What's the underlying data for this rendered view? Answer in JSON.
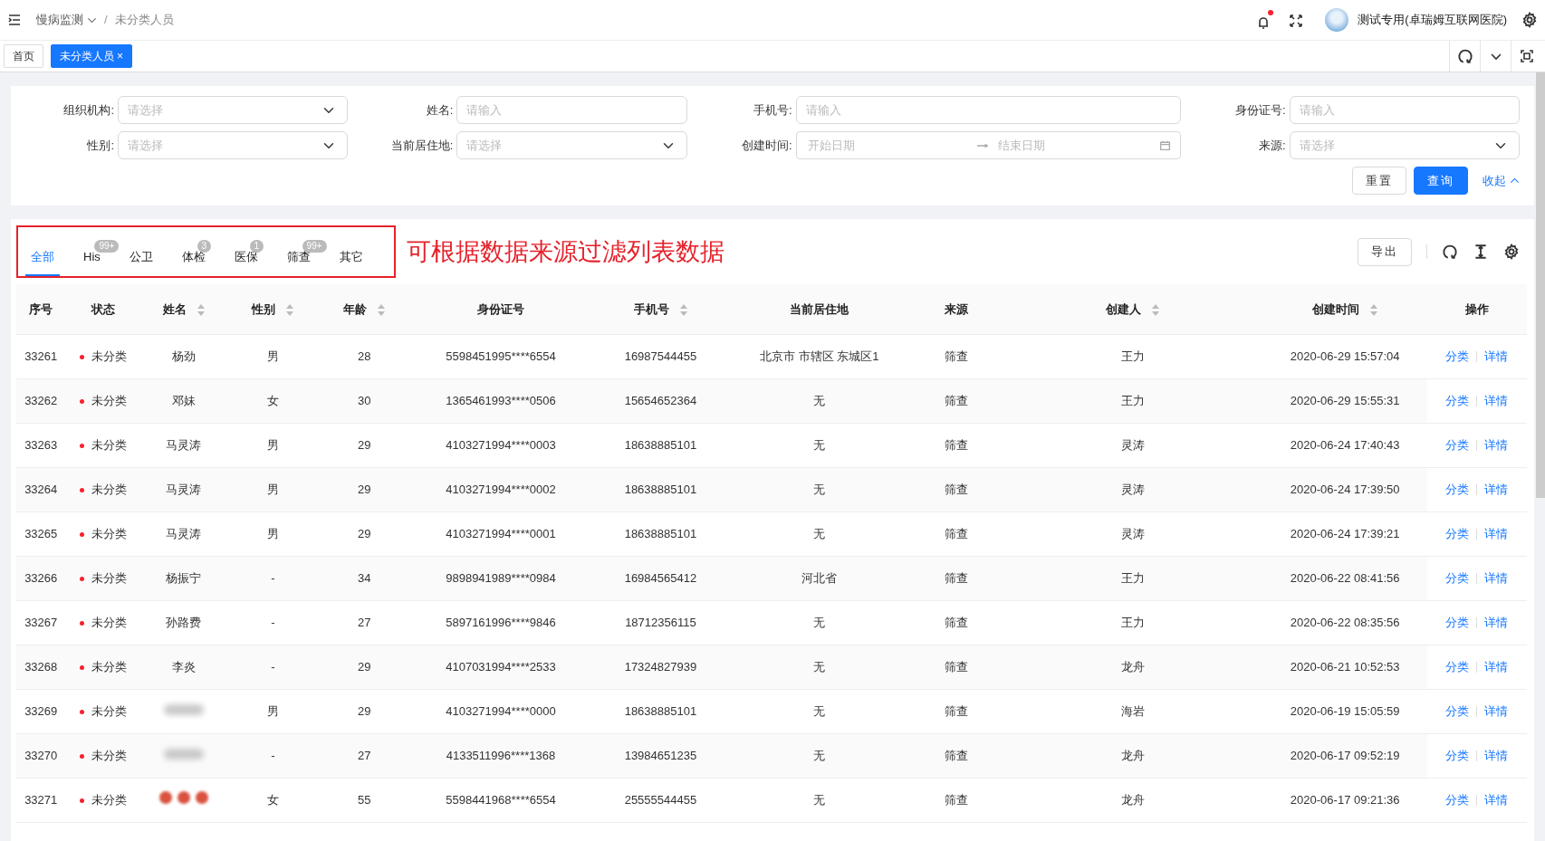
{
  "header": {
    "breadcrumb": [
      {
        "label": "慢病监测",
        "dropdown": true
      },
      {
        "label": "未分类人员",
        "dropdown": false
      }
    ],
    "separator": "/",
    "notification_dot": true,
    "user": "测试专用(卓瑞姆互联网医院)"
  },
  "page_tabs": [
    {
      "label": "首页",
      "selected": false,
      "closable": false
    },
    {
      "label": "未分类人员",
      "selected": true,
      "closable": true,
      "close": "×"
    }
  ],
  "filters": [
    {
      "label": "组织机构:",
      "kind": "select",
      "placeholder": "请选择"
    },
    {
      "label": "姓名:",
      "kind": "input",
      "placeholder": "请输入"
    },
    {
      "label": "手机号:",
      "kind": "input",
      "placeholder": "请输入"
    },
    {
      "label": "身份证号:",
      "kind": "input",
      "placeholder": "请输入"
    },
    {
      "label": "性别:",
      "kind": "select",
      "placeholder": "请选择"
    },
    {
      "label": "当前居住地:",
      "kind": "select",
      "placeholder": "请选择"
    },
    {
      "label": "创建时间:",
      "kind": "daterange",
      "placeholder": "开始日期",
      "placeholder_end": "结束日期"
    },
    {
      "label": "来源:",
      "kind": "select",
      "placeholder": "请选择"
    }
  ],
  "filter_buttons": {
    "reset": "重置",
    "search": "查询",
    "collapse": "收起"
  },
  "source_tabs": [
    {
      "label": "全部",
      "selected": true
    },
    {
      "label": "His",
      "selected": false,
      "badge": "99+"
    },
    {
      "label": "公卫",
      "selected": false
    },
    {
      "label": "体检",
      "selected": false,
      "badge": "3"
    },
    {
      "label": "医保",
      "selected": false,
      "badge": "1"
    },
    {
      "label": "筛查",
      "selected": false,
      "badge": "99+"
    },
    {
      "label": "其它",
      "selected": false
    }
  ],
  "annotation": "可根据数据来源过滤列表数据",
  "export_button": "导出",
  "table": {
    "columns": [
      {
        "label": "序号",
        "sortable": false
      },
      {
        "label": "状态",
        "sortable": false
      },
      {
        "label": "姓名",
        "sortable": true
      },
      {
        "label": "性别",
        "sortable": true
      },
      {
        "label": "年龄",
        "sortable": true
      },
      {
        "label": "身份证号",
        "sortable": false
      },
      {
        "label": "手机号",
        "sortable": true
      },
      {
        "label": "当前居住地",
        "sortable": false
      },
      {
        "label": "来源",
        "sortable": false
      },
      {
        "label": "创建人",
        "sortable": true
      },
      {
        "label": "创建时间",
        "sortable": true
      },
      {
        "label": "操作",
        "sortable": false
      }
    ],
    "rows": [
      {
        "id": "33261",
        "status": "未分类",
        "name": {
          "kind": "text",
          "text": "杨劲"
        },
        "gender": "男",
        "age": "28",
        "id_no": "5598451995****6554",
        "phone": "16987544455",
        "address": "北京市 市辖区 东城区1",
        "source": "筛查",
        "creator": "王力",
        "created": "2020-06-29 15:57:04",
        "actions": [
          "分类",
          "详情"
        ]
      },
      {
        "id": "33262",
        "status": "未分类",
        "name": {
          "kind": "text",
          "text": "邓妹"
        },
        "gender": "女",
        "age": "30",
        "id_no": "1365461993****0506",
        "phone": "15654652364",
        "address": "无",
        "source": "筛查",
        "creator": "王力",
        "created": "2020-06-29 15:55:31",
        "actions": [
          "分类",
          "详情"
        ]
      },
      {
        "id": "33263",
        "status": "未分类",
        "name": {
          "kind": "text",
          "text": "马灵涛"
        },
        "gender": "男",
        "age": "29",
        "id_no": "4103271994****0003",
        "phone": "18638885101",
        "address": "无",
        "source": "筛查",
        "creator": "灵涛",
        "created": "2020-06-24 17:40:43",
        "actions": [
          "分类",
          "详情"
        ]
      },
      {
        "id": "33264",
        "status": "未分类",
        "name": {
          "kind": "text",
          "text": "马灵涛"
        },
        "gender": "男",
        "age": "29",
        "id_no": "4103271994****0002",
        "phone": "18638885101",
        "address": "无",
        "source": "筛查",
        "creator": "灵涛",
        "created": "2020-06-24 17:39:50",
        "actions": [
          "分类",
          "详情"
        ]
      },
      {
        "id": "33265",
        "status": "未分类",
        "name": {
          "kind": "text",
          "text": "马灵涛"
        },
        "gender": "男",
        "age": "29",
        "id_no": "4103271994****0001",
        "phone": "18638885101",
        "address": "无",
        "source": "筛查",
        "creator": "灵涛",
        "created": "2020-06-24 17:39:21",
        "actions": [
          "分类",
          "详情"
        ]
      },
      {
        "id": "33266",
        "status": "未分类",
        "name": {
          "kind": "text",
          "text": "杨振宁"
        },
        "gender": "-",
        "age": "34",
        "id_no": "9898941989****0984",
        "phone": "16984565412",
        "address": "河北省",
        "source": "筛查",
        "creator": "王力",
        "created": "2020-06-22 08:41:56",
        "actions": [
          "分类",
          "详情"
        ]
      },
      {
        "id": "33267",
        "status": "未分类",
        "name": {
          "kind": "text",
          "text": "孙路费"
        },
        "gender": "-",
        "age": "27",
        "id_no": "5897161996****9846",
        "phone": "18712356115",
        "address": "无",
        "source": "筛查",
        "creator": "王力",
        "created": "2020-06-22 08:35:56",
        "actions": [
          "分类",
          "详情"
        ]
      },
      {
        "id": "33268",
        "status": "未分类",
        "name": {
          "kind": "text",
          "text": "李炎"
        },
        "gender": "-",
        "age": "29",
        "id_no": "4107031994****2533",
        "phone": "17324827939",
        "address": "无",
        "source": "筛查",
        "creator": "龙舟",
        "created": "2020-06-21 10:52:53",
        "actions": [
          "分类",
          "详情"
        ]
      },
      {
        "id": "33269",
        "status": "未分类",
        "name": {
          "kind": "blurred"
        },
        "gender": "男",
        "age": "29",
        "id_no": "4103271994****0000",
        "phone": "18638885101",
        "address": "无",
        "source": "筛查",
        "creator": "海岩",
        "created": "2020-06-19 15:05:59",
        "actions": [
          "分类",
          "详情"
        ]
      },
      {
        "id": "33270",
        "status": "未分类",
        "name": {
          "kind": "blurred"
        },
        "gender": "-",
        "age": "27",
        "id_no": "4133511996****1368",
        "phone": "13984651235",
        "address": "无",
        "source": "筛查",
        "creator": "龙舟",
        "created": "2020-06-17 09:52:19",
        "actions": [
          "分类",
          "详情"
        ]
      },
      {
        "id": "33271",
        "status": "未分类",
        "name": {
          "kind": "hearts"
        },
        "gender": "女",
        "age": "55",
        "id_no": "5598441968****6554",
        "phone": "25555544455",
        "address": "无",
        "source": "筛查",
        "creator": "龙舟",
        "created": "2020-06-17 09:21:36",
        "actions": [
          "分类",
          "详情"
        ]
      }
    ]
  }
}
